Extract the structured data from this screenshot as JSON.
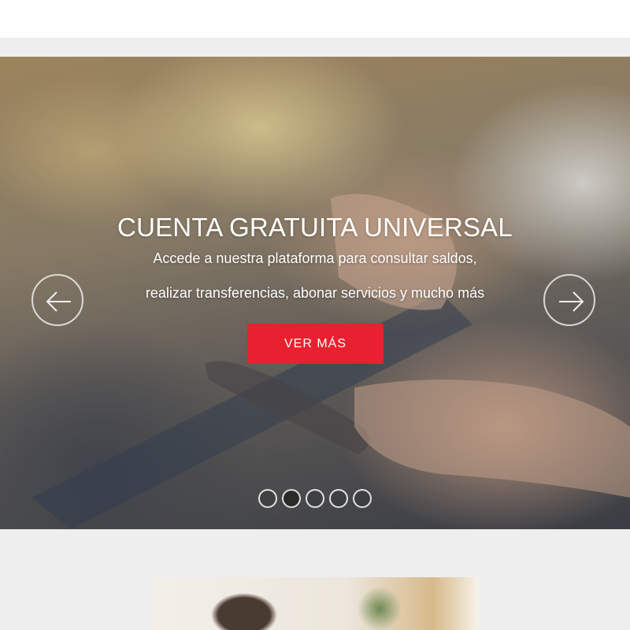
{
  "hero": {
    "title": "CUENTA GRATUITA UNIVERSAL",
    "line1": "Accede a nuestra plataforma para consultar saldos,",
    "line2": "realizar transferencias, abonar servicios y mucho más",
    "cta_label": "VER MÁS",
    "active_slide": 2,
    "slide_count": 5
  },
  "colors": {
    "accent": "#e8202f",
    "page_background": "#eeeeee",
    "header_background": "#ffffff"
  },
  "icons": {
    "prev": "arrow-left-icon",
    "next": "arrow-right-icon"
  }
}
